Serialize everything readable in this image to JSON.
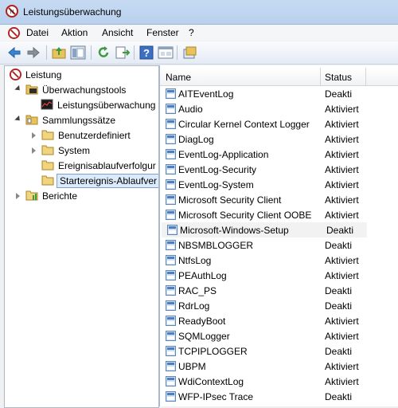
{
  "window": {
    "title": "Leistungsüberwachung"
  },
  "menu": [
    "Datei",
    "Aktion",
    "Ansicht",
    "Fenster",
    "?"
  ],
  "tree": {
    "root": "Leistung",
    "monitor_tools": "Überwachungstools",
    "perf_monitor": "Leistungsüberwachung",
    "collector_sets": "Sammlungssätze",
    "user_defined": "Benutzerdefiniert",
    "system": "System",
    "event_trace": "Ereignisablaufverfolgur",
    "startup_trace": "Startereignis-Ablaufver",
    "reports": "Berichte"
  },
  "table": {
    "col_name": "Name",
    "col_status": "Status",
    "rows": [
      {
        "name": "AITEventLog",
        "status": "Deakti"
      },
      {
        "name": "Audio",
        "status": "Aktiviert"
      },
      {
        "name": "Circular Kernel Context Logger",
        "status": "Aktiviert"
      },
      {
        "name": "DiagLog",
        "status": "Aktiviert"
      },
      {
        "name": "EventLog-Application",
        "status": "Aktiviert"
      },
      {
        "name": "EventLog-Security",
        "status": "Aktiviert"
      },
      {
        "name": "EventLog-System",
        "status": "Aktiviert"
      },
      {
        "name": "Microsoft Security Client",
        "status": "Aktiviert"
      },
      {
        "name": "Microsoft Security Client OOBE",
        "status": "Aktiviert"
      },
      {
        "name": "Microsoft-Windows-Setup",
        "status": "Deakti"
      },
      {
        "name": "NBSMBLOGGER",
        "status": "Deakti"
      },
      {
        "name": "NtfsLog",
        "status": "Aktiviert"
      },
      {
        "name": "PEAuthLog",
        "status": "Aktiviert"
      },
      {
        "name": "RAC_PS",
        "status": "Deakti"
      },
      {
        "name": "RdrLog",
        "status": "Deakti"
      },
      {
        "name": "ReadyBoot",
        "status": "Aktiviert"
      },
      {
        "name": "SQMLogger",
        "status": "Aktiviert"
      },
      {
        "name": "TCPIPLOGGER",
        "status": "Deakti"
      },
      {
        "name": "UBPM",
        "status": "Aktiviert"
      },
      {
        "name": "WdiContextLog",
        "status": "Aktiviert"
      },
      {
        "name": "WFP-IPsec Trace",
        "status": "Deakti"
      }
    ]
  }
}
